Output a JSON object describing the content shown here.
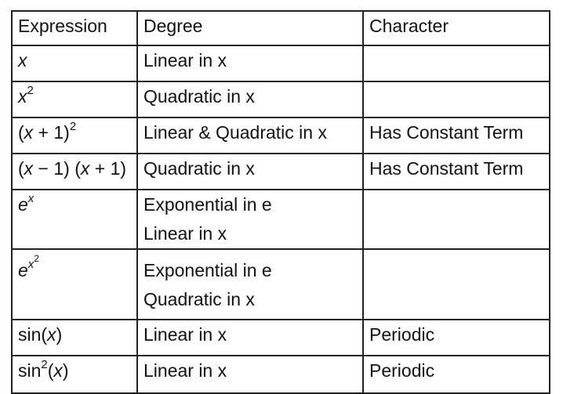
{
  "table": {
    "headers": [
      "Expression",
      "Degree",
      "Character"
    ],
    "rows": [
      {
        "expression": {
          "base": "x",
          "sup": "",
          "sup2": ""
        },
        "degree_lines": [
          "Linear in x"
        ],
        "character": ""
      },
      {
        "expression": {
          "base": "x",
          "sup": "2",
          "sup2": ""
        },
        "degree_lines": [
          "Quadratic in x"
        ],
        "character": ""
      },
      {
        "expression": {
          "pre": "(",
          "var": "x",
          "post": " + 1)",
          "sup": "2"
        },
        "degree_lines": [
          "Linear & Quadratic in x"
        ],
        "character": "Has Constant Term"
      },
      {
        "expression": {
          "p1": "(",
          "v1": "x",
          "m1": " − 1) (",
          "v2": "x",
          "m2": " + 1)"
        },
        "degree_lines": [
          "Quadratic in x"
        ],
        "character": "Has Constant Term"
      },
      {
        "expression": {
          "base": "e",
          "sup": "x",
          "sup2": ""
        },
        "degree_lines": [
          "Exponential in e",
          "Linear in x"
        ],
        "character": ""
      },
      {
        "expression": {
          "base": "e",
          "sup": "x",
          "sup2": "2"
        },
        "degree_lines": [
          "Exponential in e",
          "Quadratic in x"
        ],
        "character": ""
      },
      {
        "expression": {
          "fn": "sin",
          "sup": "",
          "open": "(",
          "var": "x",
          "close": ")"
        },
        "degree_lines": [
          "Linear in x"
        ],
        "character": "Periodic"
      },
      {
        "expression": {
          "fn": "sin",
          "sup": "2",
          "open": "(",
          "var": "x",
          "close": ")"
        },
        "degree_lines": [
          "Linear in x"
        ],
        "character": "Periodic"
      }
    ]
  }
}
